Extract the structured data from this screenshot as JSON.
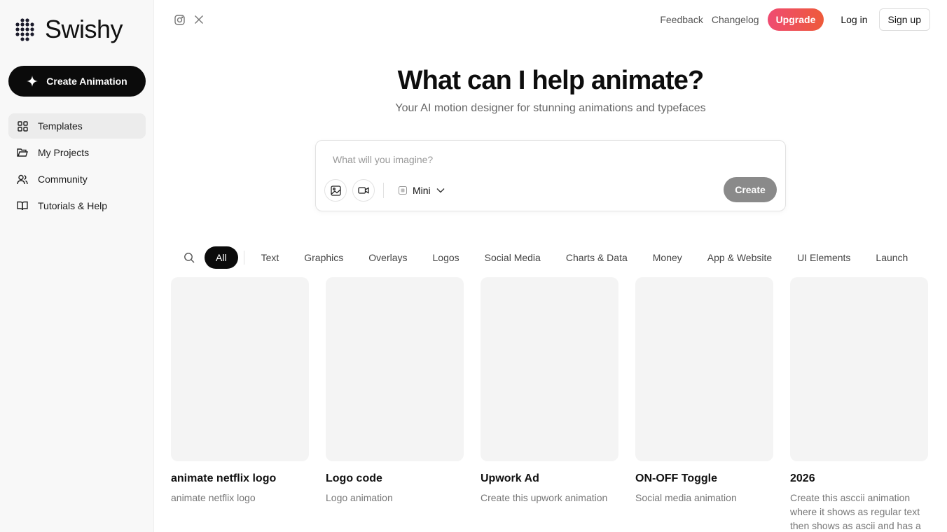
{
  "app": {
    "name": "Swishy"
  },
  "sidebar": {
    "create_label": "Create Animation",
    "items": [
      {
        "label": "Templates",
        "icon": "grid-icon",
        "active": true
      },
      {
        "label": "My Projects",
        "icon": "folder-icon",
        "active": false
      },
      {
        "label": "Community",
        "icon": "users-icon",
        "active": false
      },
      {
        "label": "Tutorials & Help",
        "icon": "book-open-icon",
        "active": false
      }
    ]
  },
  "header": {
    "social": [
      "instagram-icon",
      "x-icon"
    ],
    "feedback": "Feedback",
    "changelog": "Changelog",
    "upgrade": "Upgrade",
    "login": "Log in",
    "signup": "Sign up"
  },
  "hero": {
    "title": "What can I help animate?",
    "subtitle": "Your AI motion designer for stunning animations and typefaces"
  },
  "prompt": {
    "placeholder": "What will you imagine?",
    "model": "Mini",
    "submit": "Create"
  },
  "filters": {
    "active": "All",
    "items": [
      "All",
      "Text",
      "Graphics",
      "Overlays",
      "Logos",
      "Social Media",
      "Charts & Data",
      "Money",
      "App & Website",
      "UI Elements",
      "Launch"
    ]
  },
  "cards": [
    {
      "title": "animate netflix logo",
      "desc": "animate netflix logo"
    },
    {
      "title": "Logo code",
      "desc": "Logo animation"
    },
    {
      "title": "Upwork Ad",
      "desc": "Create this upwork animation"
    },
    {
      "title": "ON-OFF Toggle",
      "desc": "Social media animation"
    },
    {
      "title": "2026",
      "desc": "Create this asccii animation where it shows as regular text then shows as ascii and has a"
    }
  ],
  "colors": {
    "upgrade_start": "#ef4b72",
    "upgrade_end": "#ee5a3a",
    "primary": "#0b0b0b"
  }
}
